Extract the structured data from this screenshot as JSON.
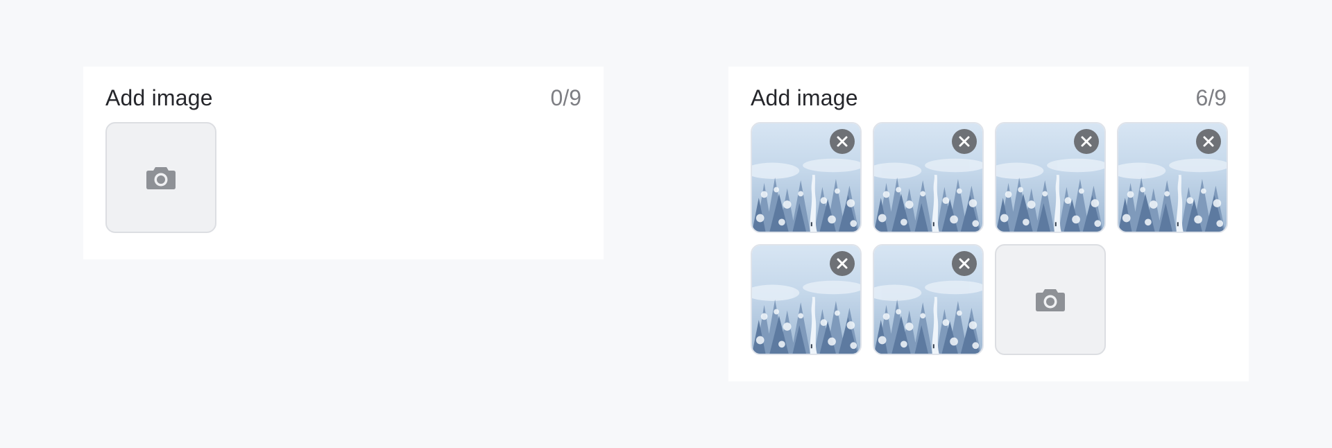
{
  "colors": {
    "page_background": "#f7f8fa",
    "panel_background": "#ffffff",
    "upload_tile_background": "#f0f1f3",
    "camera_icon": "#8e9196",
    "remove_button": "#6e7176"
  },
  "uploaders": [
    {
      "title": "Add image",
      "count_label": "0/9",
      "images": [],
      "upload_tile": {
        "icon": "camera-icon"
      }
    },
    {
      "title": "Add image",
      "count_label": "6/9",
      "images": [
        {
          "thumbnail": "snowy-forest",
          "remove_icon": "close-icon"
        },
        {
          "thumbnail": "snowy-forest",
          "remove_icon": "close-icon"
        },
        {
          "thumbnail": "snowy-forest",
          "remove_icon": "close-icon"
        },
        {
          "thumbnail": "snowy-forest",
          "remove_icon": "close-icon"
        },
        {
          "thumbnail": "snowy-forest",
          "remove_icon": "close-icon"
        },
        {
          "thumbnail": "snowy-forest",
          "remove_icon": "close-icon"
        }
      ],
      "upload_tile": {
        "icon": "camera-icon"
      }
    }
  ]
}
